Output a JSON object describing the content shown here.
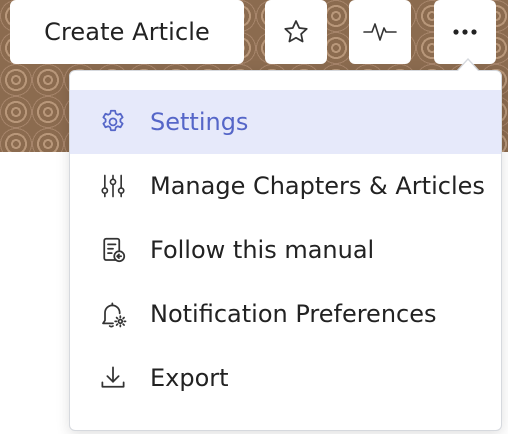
{
  "toolbar": {
    "create_article_label": "Create Article",
    "icons": [
      "star-icon",
      "activity-pulse-icon",
      "more-horizontal-icon"
    ]
  },
  "menu": {
    "items": [
      {
        "label": "Settings",
        "icon": "gear-icon",
        "active": true
      },
      {
        "label": "Manage Chapters & Articles",
        "icon": "sliders-icon",
        "active": false
      },
      {
        "label": "Follow this manual",
        "icon": "follow-document-icon",
        "active": false
      },
      {
        "label": "Notification Preferences",
        "icon": "bell-settings-icon",
        "active": false
      },
      {
        "label": "Export",
        "icon": "download-icon",
        "active": false
      }
    ]
  },
  "colors": {
    "accent": "#5566c8",
    "active_bg": "#e6e9fa",
    "banner": "#8b6b4f"
  }
}
